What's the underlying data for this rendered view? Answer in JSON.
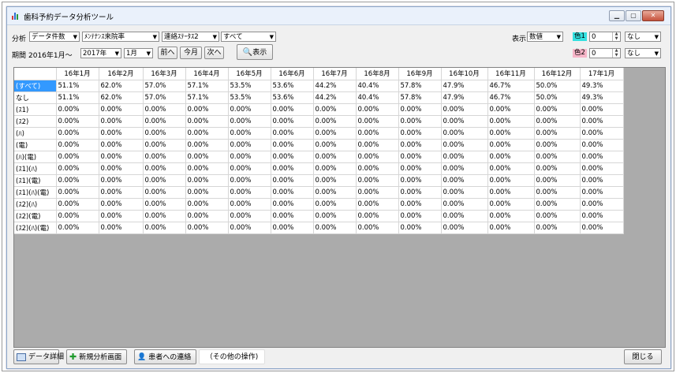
{
  "window": {
    "title": "歯科予約データ分析ツール"
  },
  "toolbar": {
    "analysis_label": "分析",
    "analysis_type": "データ件数",
    "metric": "ﾒﾝﾃﾅﾝｽ来院率",
    "status_filter": "連絡ｽﾃｰﾀｽ2",
    "status_value": "すべて",
    "period_label": "期間",
    "period_start": "2016年1月～",
    "end_year": "2017年",
    "end_month": "1月",
    "prev_label": "前へ",
    "this_month_label": "今月",
    "next_label": "次へ",
    "show_label": "表示",
    "display_label": "表示",
    "display_mode": "数値",
    "color1_label": "色1",
    "color1_value": "0",
    "color1_option": "なし",
    "color2_label": "色2",
    "color2_value": "0",
    "color2_option": "なし",
    "colors": {
      "color1_bg": "#33e0e0",
      "color2_bg": "#f7b5c8"
    }
  },
  "table": {
    "columns": [
      "16年1月",
      "16年2月",
      "16年3月",
      "16年4月",
      "16年5月",
      "16年6月",
      "16年7月",
      "16年8月",
      "16年9月",
      "16年10月",
      "16年11月",
      "16年12月",
      "17年1月"
    ],
    "rows": [
      {
        "label": "(すべて)",
        "values": [
          "51.1%",
          "62.0%",
          "57.0%",
          "57.1%",
          "53.5%",
          "53.6%",
          "44.2%",
          "40.4%",
          "57.8%",
          "47.9%",
          "46.7%",
          "50.0%",
          "49.3%"
        ]
      },
      {
        "label": "なし",
        "values": [
          "51.1%",
          "62.0%",
          "57.0%",
          "57.1%",
          "53.5%",
          "53.6%",
          "44.2%",
          "40.4%",
          "57.8%",
          "47.9%",
          "46.7%",
          "50.0%",
          "49.3%"
        ]
      },
      {
        "label": "(ｽ1)",
        "values": [
          "0.00%",
          "0.00%",
          "0.00%",
          "0.00%",
          "0.00%",
          "0.00%",
          "0.00%",
          "0.00%",
          "0.00%",
          "0.00%",
          "0.00%",
          "0.00%",
          "0.00%"
        ]
      },
      {
        "label": "(ｽ2)",
        "values": [
          "0.00%",
          "0.00%",
          "0.00%",
          "0.00%",
          "0.00%",
          "0.00%",
          "0.00%",
          "0.00%",
          "0.00%",
          "0.00%",
          "0.00%",
          "0.00%",
          "0.00%"
        ]
      },
      {
        "label": "(ﾊ)",
        "values": [
          "0.00%",
          "0.00%",
          "0.00%",
          "0.00%",
          "0.00%",
          "0.00%",
          "0.00%",
          "0.00%",
          "0.00%",
          "0.00%",
          "0.00%",
          "0.00%",
          "0.00%"
        ]
      },
      {
        "label": "(電)",
        "values": [
          "0.00%",
          "0.00%",
          "0.00%",
          "0.00%",
          "0.00%",
          "0.00%",
          "0.00%",
          "0.00%",
          "0.00%",
          "0.00%",
          "0.00%",
          "0.00%",
          "0.00%"
        ]
      },
      {
        "label": "(ﾊ)(電)",
        "values": [
          "0.00%",
          "0.00%",
          "0.00%",
          "0.00%",
          "0.00%",
          "0.00%",
          "0.00%",
          "0.00%",
          "0.00%",
          "0.00%",
          "0.00%",
          "0.00%",
          "0.00%"
        ]
      },
      {
        "label": "(ｽ1)(ﾊ)",
        "values": [
          "0.00%",
          "0.00%",
          "0.00%",
          "0.00%",
          "0.00%",
          "0.00%",
          "0.00%",
          "0.00%",
          "0.00%",
          "0.00%",
          "0.00%",
          "0.00%",
          "0.00%"
        ]
      },
      {
        "label": "(ｽ1)(電)",
        "values": [
          "0.00%",
          "0.00%",
          "0.00%",
          "0.00%",
          "0.00%",
          "0.00%",
          "0.00%",
          "0.00%",
          "0.00%",
          "0.00%",
          "0.00%",
          "0.00%",
          "0.00%"
        ]
      },
      {
        "label": "(ｽ1)(ﾊ)(電)",
        "values": [
          "0.00%",
          "0.00%",
          "0.00%",
          "0.00%",
          "0.00%",
          "0.00%",
          "0.00%",
          "0.00%",
          "0.00%",
          "0.00%",
          "0.00%",
          "0.00%",
          "0.00%"
        ]
      },
      {
        "label": "(ｽ2)(ﾊ)",
        "values": [
          "0.00%",
          "0.00%",
          "0.00%",
          "0.00%",
          "0.00%",
          "0.00%",
          "0.00%",
          "0.00%",
          "0.00%",
          "0.00%",
          "0.00%",
          "0.00%",
          "0.00%"
        ]
      },
      {
        "label": "(ｽ2)(電)",
        "values": [
          "0.00%",
          "0.00%",
          "0.00%",
          "0.00%",
          "0.00%",
          "0.00%",
          "0.00%",
          "0.00%",
          "0.00%",
          "0.00%",
          "0.00%",
          "0.00%",
          "0.00%"
        ]
      },
      {
        "label": "(ｽ2)(ﾊ)(電)",
        "values": [
          "0.00%",
          "0.00%",
          "0.00%",
          "0.00%",
          "0.00%",
          "0.00%",
          "0.00%",
          "0.00%",
          "0.00%",
          "0.00%",
          "0.00%",
          "0.00%",
          "0.00%"
        ]
      }
    ],
    "selected_row": 0
  },
  "footer": {
    "detail_label": "データ詳細",
    "new_analysis_label": "新規分析画面",
    "contact_label": "患者への連絡",
    "other_ops_label": "（その他の操作)",
    "close_label": "閉じる"
  }
}
